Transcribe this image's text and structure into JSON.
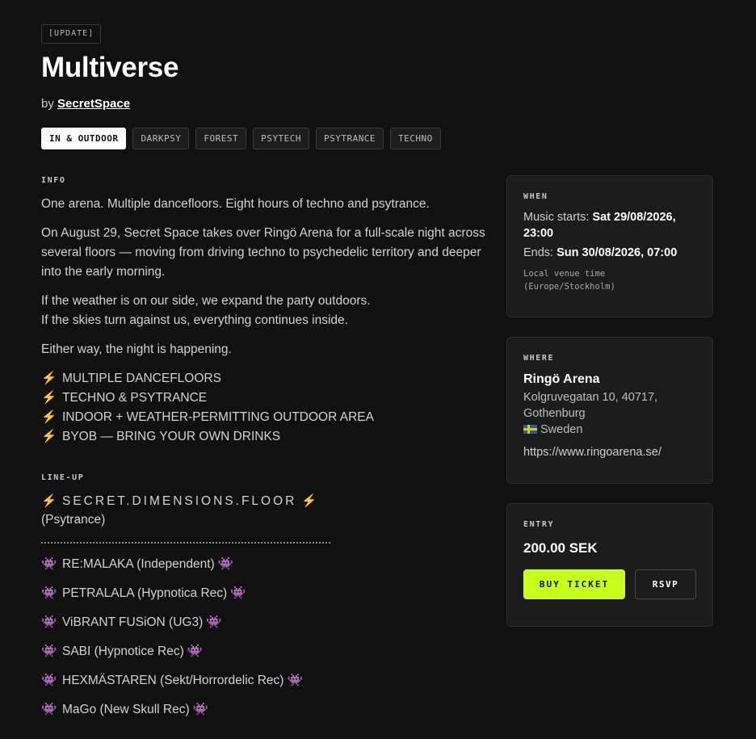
{
  "header": {
    "badge": "[UPDATE]",
    "title": "Multiverse",
    "by_prefix": "by",
    "organizer": "SecretSpace"
  },
  "tags": [
    "IN & OUTDOOR",
    "DARKPSY",
    "FOREST",
    "PSYTECH",
    "PSYTRANCE",
    "TECHNO"
  ],
  "info": {
    "label": "INFO",
    "p1": "One arena. Multiple dancefloors. Eight hours of techno and psytrance.",
    "p2": "On August 29, Secret Space takes over Ringö Arena for a full-scale night across several floors — moving from driving techno to psychedelic territory and deeper into the early morning.",
    "p3a": "If the weather is on our side, we expand the party outdoors.",
    "p3b": "If the skies turn against us, everything continues inside.",
    "p4": "Either way, the night is happening.",
    "bullet_icon": "lightning-icon",
    "bullets": [
      "MULTIPLE DANCEFLOORS",
      "TECHNO & PSYTRANCE",
      "INDOOR + WEATHER-PERMITTING OUTDOOR AREA",
      "BYOB — BRING YOUR OWN DRINKS"
    ]
  },
  "lineup": {
    "label": "LINE-UP",
    "floor_title": "SECRET.DIMENSIONS.FLOOR",
    "floor_genre": "(Psytrance)",
    "artist_icon": "alien-monster-icon",
    "artists": [
      "RE:MALAKA (Independent)",
      "PETRALALA (Hypnotica Rec)",
      "ViBRANT FUSiON (UG3)",
      "SABI (Hypnotice Rec)",
      "HEXMÄSTAREN (Sekt/Horrordelic Rec)",
      "MaGo (New Skull Rec)"
    ]
  },
  "when": {
    "label": "WHEN",
    "starts_label": "Music starts:",
    "starts_value": "Sat 29/08/2026, 23:00",
    "ends_label": "Ends:",
    "ends_value": "Sun 30/08/2026, 07:00",
    "tz_note": "Local venue time (Europe/Stockholm)"
  },
  "where": {
    "label": "WHERE",
    "venue": "Ringö Arena",
    "address": "Kolgruvegatan 10, 40717, Gothenburg",
    "country": "Sweden",
    "url": "https://www.ringoarena.se/"
  },
  "entry": {
    "label": "ENTRY",
    "price": "200.00 SEK",
    "buy_label": "BUY TICKET",
    "rsvp_label": "RSVP"
  },
  "colors": {
    "accent": "#c6ff1a",
    "background": "#111111",
    "card": "#1c1c1c",
    "bolt": "#ff8a3d",
    "alien": "#8a6cd8"
  }
}
